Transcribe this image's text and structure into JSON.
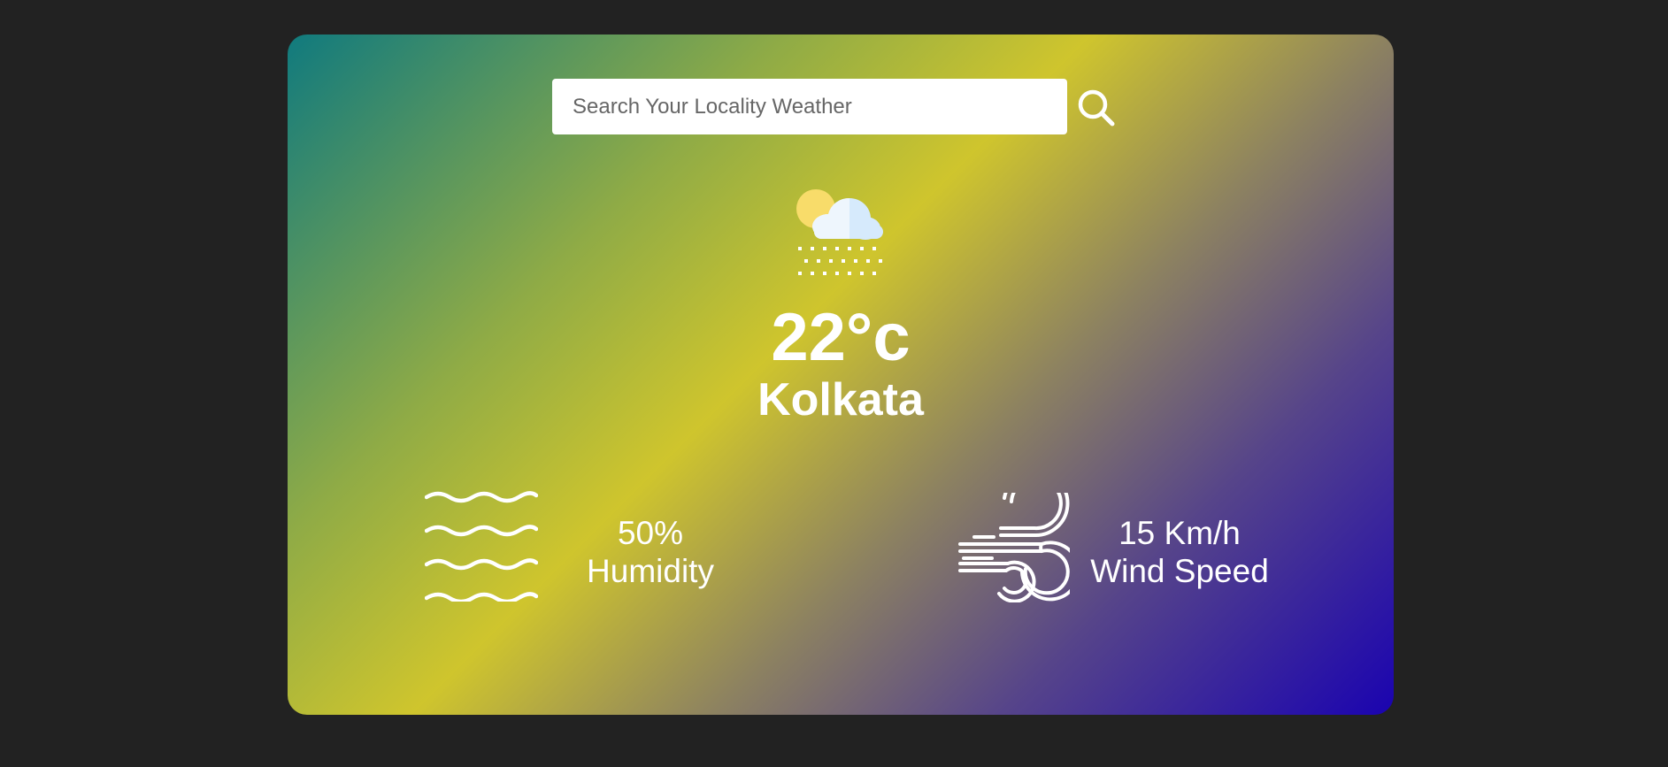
{
  "search": {
    "placeholder": "Search Your Locality Weather"
  },
  "icons": {
    "search": "search-icon",
    "weather": "partly-cloudy-snow-icon",
    "humidity": "humidity-waves-icon",
    "wind": "wind-icon"
  },
  "weather": {
    "temperature": "22°c",
    "city": "Kolkata"
  },
  "humidity": {
    "value": "50%",
    "label": "Humidity"
  },
  "wind": {
    "value": "15 Km/h",
    "label": "Wind Speed"
  },
  "colors": {
    "page_background": "#222222",
    "gradient_start": "#107a7e",
    "gradient_mid": "#cfc52d",
    "gradient_end": "#1a03b0",
    "text": "#ffffff"
  }
}
